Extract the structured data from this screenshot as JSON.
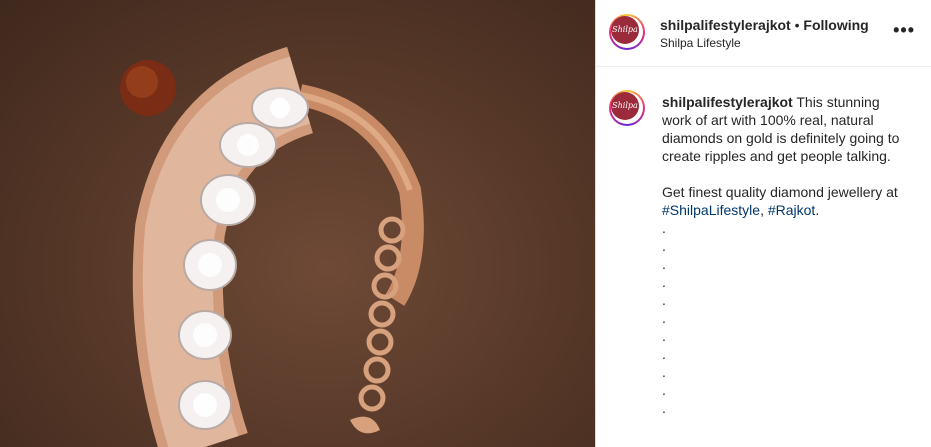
{
  "post": {
    "username": "shilpalifestylerajkot",
    "separator": "•",
    "follow_status": "Following",
    "location": "Shilpa Lifestyle",
    "avatar_text": "Shilpa",
    "more_icon": "more-horizontal-icon"
  },
  "caption": {
    "username": "shilpalifestylerajkot",
    "text1": "This stunning work of art with 100% real, natural diamonds on gold is definitely going to create ripples and get people talking.",
    "text2": "Get finest quality diamond jewellery at",
    "hashtag1": "#ShilpaLifestyle",
    "comma": ",",
    "hashtag2": "#Rajkot",
    "period": ".",
    "dots": [
      ".",
      ".",
      ".",
      ".",
      ".",
      ".",
      ".",
      ".",
      ".",
      ".",
      "."
    ]
  },
  "colors": {
    "avatar_bg": "#9b2a3a",
    "hashtag": "#00376b",
    "text": "#262626"
  }
}
